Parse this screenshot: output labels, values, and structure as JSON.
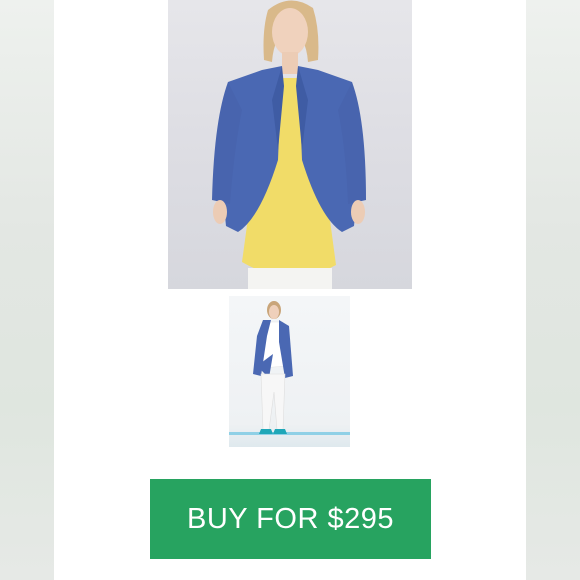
{
  "product": {
    "main_image_alt": "",
    "thumbnail_alt": ""
  },
  "buy_button": {
    "label": "BUY FOR $295"
  },
  "footer": {
    "cut_text": ""
  },
  "colors": {
    "button": "#27a360",
    "jacket": "#4a68b3",
    "top": "#f1dc68",
    "background": "#ffffff",
    "side_panel": "#e6e9e6",
    "shoes": "#1fa7b8"
  }
}
